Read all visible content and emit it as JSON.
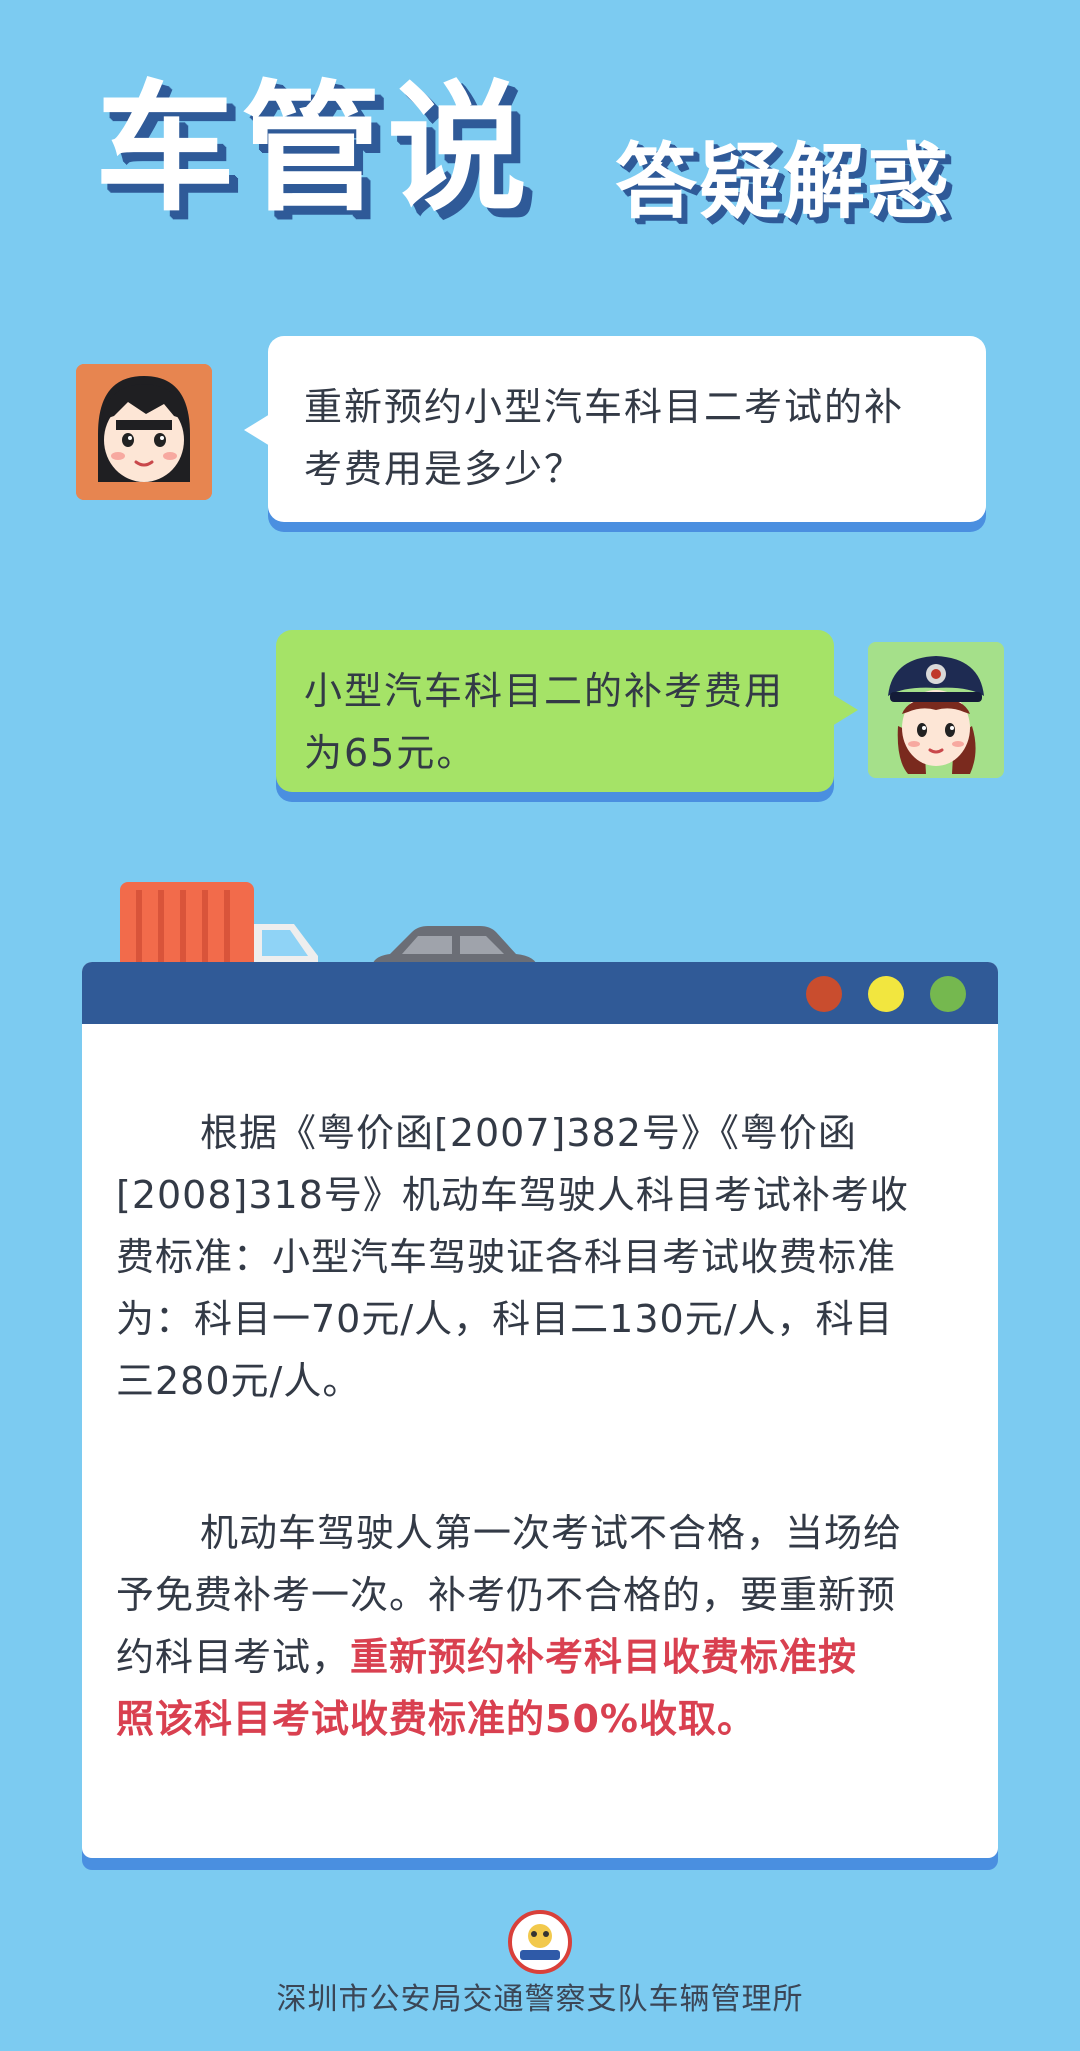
{
  "title": {
    "main": "车管说",
    "sub": "答疑解惑"
  },
  "chat": {
    "question": {
      "avatar": "girl-avatar-icon",
      "line1": "重新预约小型汽车科目二考试的补",
      "line2": "考费用是多少？"
    },
    "answer": {
      "avatar": "police-officer-avatar-icon",
      "line1": "小型汽车科目二的补考费用",
      "line2": "为65元。"
    }
  },
  "card": {
    "paragraph1": {
      "line1": "根据《粤价函[2007]382号》《粤价函",
      "line2": "[2008]318号》机动车驾驶人科目考试补考收",
      "line3": "费标准：小型汽车驾驶证各科目考试收费标准",
      "line4": "为：科目一70元/人，科目二130元/人，科目",
      "line5": "三280元/人。"
    },
    "paragraph2": {
      "line1": "机动车驾驶人第一次考试不合格，当场给",
      "line2": "予免费补考一次。补考仍不合格的，要重新预",
      "line3_plain": "约科目考试，",
      "line3_highlight": "重新预约补考科目收费标准按",
      "line4_highlight": "照该科目考试收费标准的50%收取。"
    }
  },
  "footer": {
    "badge": "traffic-police-badge-icon",
    "text": "深圳市公安局交通警察支队车辆管理所"
  },
  "colors": {
    "background": "#7ccbf1",
    "header_bar": "#305a97",
    "highlight": "#d94050",
    "answer_bubble": "#a5e367"
  }
}
